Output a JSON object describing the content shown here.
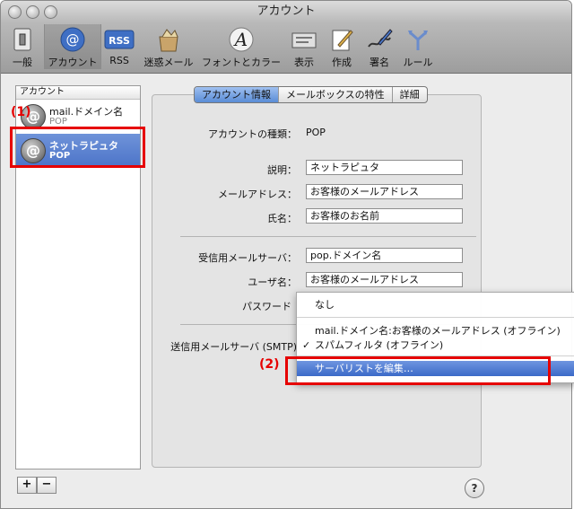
{
  "window": {
    "title": "アカウント"
  },
  "toolbar": {
    "items": [
      {
        "label": "一般",
        "icon": "switch-icon"
      },
      {
        "label": "アカウント",
        "icon": "at-sign-icon",
        "selected": true
      },
      {
        "label": "RSS",
        "icon": "rss-icon"
      },
      {
        "label": "迷惑メール",
        "icon": "junk-mail-icon"
      },
      {
        "label": "フォントとカラー",
        "icon": "font-icon"
      },
      {
        "label": "表示",
        "icon": "view-icon"
      },
      {
        "label": "作成",
        "icon": "compose-icon"
      },
      {
        "label": "署名",
        "icon": "signature-icon"
      },
      {
        "label": "ルール",
        "icon": "rules-icon"
      }
    ]
  },
  "sidebar": {
    "header": "アカウント",
    "accounts": [
      {
        "name": "mail.ドメイン名",
        "type": "POP"
      },
      {
        "name": "ネットラピュタ",
        "type": "POP",
        "selected": true
      }
    ],
    "add_label": "+",
    "remove_label": "−"
  },
  "tabs": [
    {
      "label": "アカウント情報",
      "selected": true
    },
    {
      "label": "メールボックスの特性"
    },
    {
      "label": "詳細"
    }
  ],
  "form": {
    "account_type_label": "アカウントの種類：",
    "account_type_value": "POP",
    "description_label": "説明：",
    "description_value": "ネットラピュタ",
    "email_label": "メールアドレス：",
    "email_value": "お客様のメールアドレス",
    "fullname_label": "氏名：",
    "fullname_value": "お客様のお名前",
    "incoming_label": "受信用メールサーバ：",
    "incoming_value": "pop.ドメイン名",
    "username_label": "ユーザ名：",
    "username_value": "お客様のメールアドレス",
    "password_label": "パスワード",
    "smtp_label": "送信用メールサーバ (SMTP)"
  },
  "smtp_menu": {
    "items": [
      {
        "label": "なし"
      },
      {
        "label": "mail.ドメイン名:お客様のメールアドレス (オフライン)"
      },
      {
        "label": "スパムフィルタ (オフライン)",
        "checked": true,
        "check": "✓"
      },
      {
        "label": "サーバリストを編集…",
        "highlighted": true
      }
    ]
  },
  "callouts": {
    "one": "(1)",
    "two": "(2)"
  },
  "help_label": "?",
  "colors": {
    "highlight": "#e60000",
    "selection": "#5a82d0"
  }
}
